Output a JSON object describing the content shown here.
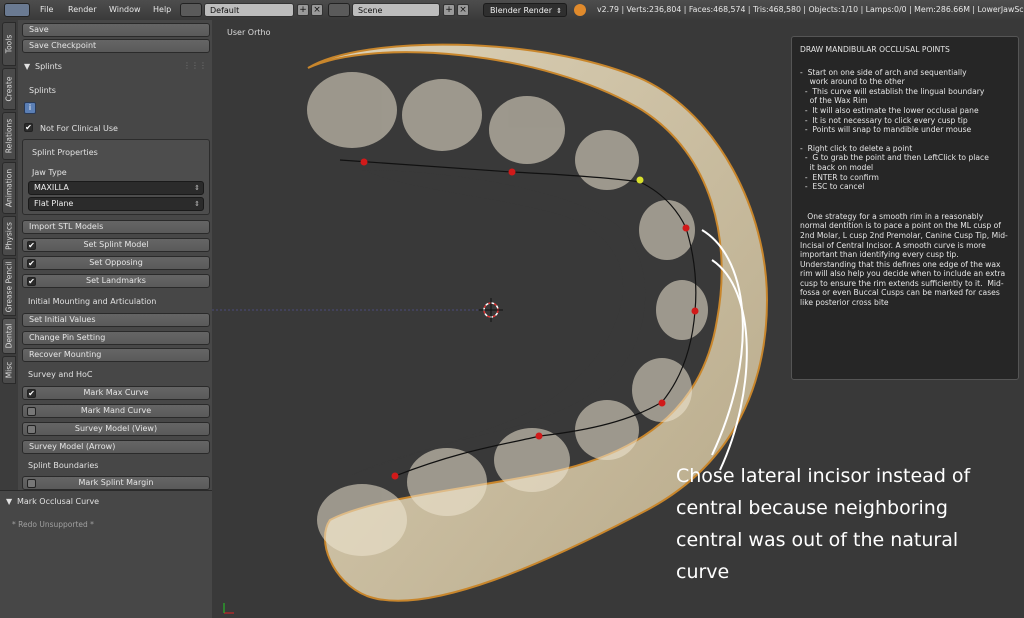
{
  "topbar": {
    "menu": [
      "File",
      "Render",
      "Window",
      "Help"
    ],
    "screen_layout": "Default",
    "scene": "Scene",
    "render_engine": "Blender Render",
    "stats": "v2.79 | Verts:236,804 | Faces:468,574 | Tris:468,580 | Objects:1/10 | Lamps:0/0 | Mem:286.66M | LowerJawSca"
  },
  "tabs": [
    "Tools",
    "Create",
    "Relations",
    "Animation",
    "Physics",
    "Grease Pencil",
    "Dental",
    "Misc"
  ],
  "panel": {
    "save": "Save",
    "save_checkpoint": "Save Checkpoint",
    "splints_header": "Splints",
    "splints_label": "Splints",
    "not_for_clinical": "Not For Clinical Use",
    "splint_properties": "Splint Properties",
    "jaw_type_label": "Jaw Type",
    "jaw_type_value": "MAXILLA",
    "plane_value": "Flat Plane",
    "import_stl": "Import STL Models",
    "set_splint_model": "Set Splint Model",
    "set_opposing": "Set Opposing",
    "set_landmarks": "Set Landmarks",
    "initial_mounting": "Initial Mounting and Articulation",
    "set_initial_values": "Set Initial Values",
    "change_pin": "Change Pin Setting",
    "recover_mounting": "Recover Mounting",
    "survey_hoc": "Survey and HoC",
    "mark_max_curve": "Mark Max Curve",
    "mark_mand_curve": "Mark Mand Curve",
    "survey_model_view": "Survey Model (View)",
    "survey_model_arrow": "Survey Model (Arrow)",
    "splint_boundaries": "Splint Boundaries",
    "mark_splint_margin": "Mark Splint Margin"
  },
  "redo": {
    "title": "Mark Occlusal Curve",
    "unsupported": "* Redo Unsupported *"
  },
  "viewport": {
    "view_label": "User Ortho"
  },
  "info_box": {
    "title": "DRAW MANDIBULAR OCCLUSAL POINTS",
    "lines1": "-  Start on one side of arch and sequentially\n    work around to the other\n  -  This curve will establish the lingual boundary\n    of the Wax Rim\n  -  It will also estimate the lower occlusal pane\n  -  It is not necessary to click every cusp tip\n  -  Points will snap to mandible under mouse",
    "lines2": "-  Right click to delete a point\n  -  G to grab the point and then LeftClick to place\n    it back on model\n  -  ENTER to confirm\n  -  ESC to cancel",
    "paragraph": "   One strategy for a smooth rim in a reasonably normal dentition is to pace a point on the ML cusp of 2nd Molar, L cusp 2nd Premolar, Canine Cusp Tip, Mid-Incisal of Central Incisor. A smooth curve is more important than identifying every cusp tip. Understanding that this defines one edge of the wax rim will also help you decide when to include an extra cusp to ensure the rim extends sufficiently to it.  Mid-fossa or even Buccal Cusps can be marked for cases like posterior cross bite"
  },
  "annotation": {
    "l1": "Chose lateral incisor instead of",
    "l2": "central because neighboring",
    "l3": "central was out of the natural",
    "l4": "curve"
  },
  "colors": {
    "point_red": "#d11a1a",
    "point_selected": "#d8e02c",
    "model_surface": "#cdbfa2",
    "model_outline": "#c8862c"
  }
}
